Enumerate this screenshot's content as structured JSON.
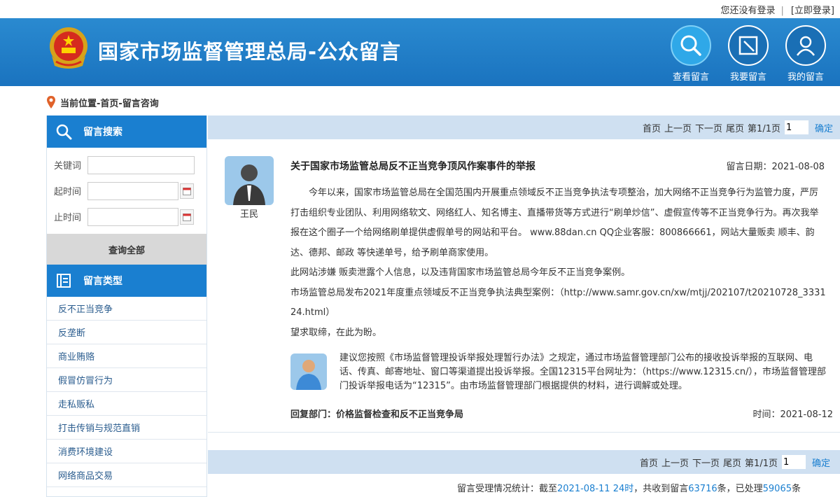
{
  "topbar": {
    "not_logged": "您还没有登录",
    "separator": "|",
    "login": "[立即登录]"
  },
  "header": {
    "site_title": "国家市场监督管理总局-公众留言"
  },
  "nav": [
    {
      "label": "查看留言",
      "icon": "search-icon"
    },
    {
      "label": "我要留言",
      "icon": "compose-icon"
    },
    {
      "label": "我的留言",
      "icon": "user-icon"
    }
  ],
  "breadcrumb": "当前位置-首页-留言咨询",
  "sidebar": {
    "search_title": "留言搜索",
    "keyword_label": "关键词",
    "start_label": "起时间",
    "end_label": "止时间",
    "query_all": "查询全部",
    "types_title": "留言类型",
    "types": [
      "反不正当竞争",
      "反垄断",
      "商业贿赂",
      "假冒仿冒行为",
      "走私贩私",
      "打击传销与规范直销",
      "消费环境建设",
      "网络商品交易"
    ]
  },
  "pager": {
    "first": "首页",
    "prev": "上一页",
    "next": "下一页",
    "last": "尾页",
    "page_info": "第1/1页",
    "page_value": "1",
    "confirm": "确定"
  },
  "message": {
    "author": "王民",
    "title": "关于国家市场监管总局反不正当竞争顶风作案事件的举报",
    "date": "留言日期：2021-08-08",
    "body": [
      "今年以来，国家市场监管总局在全国范围内开展重点领域反不正当竞争执法专项整治，加大网络不正当竞争行为监管力度，严厉打击组织专业团队、利用网络软文、网络红人、知名博主、直播带货等方式进行“刷单炒信”、虚假宣传等不正当竞争行为。再次我举报在这个圈子一个给网络刷单提供虚假单号的网站和平台。 www.88dan.cn QQ企业客服：800866661，网站大量贩卖 顺丰、韵达、德邦、邮政 等快递单号，给予刷单商家使用。",
      "此网站涉嫌 贩卖泄露个人信息，以及违背国家市场监管总局今年反不正当竞争案例。",
      "市场监管总局发布2021年度重点领域反不正当竞争执法典型案例：（http://www.samr.gov.cn/xw/mtjj/202107/t20210728_333124.html）",
      "望求取缔，在此为盼。"
    ]
  },
  "reply": {
    "text": "建议您按照《市场监督管理投诉举报处理暂行办法》之规定，通过市场监督管理部门公布的接收投诉举报的互联网、电话、传真、邮寄地址、窗口等渠道提出投诉举报。全国12315平台网址为：（https://www.12315.cn/），市场监督管理部门投诉举报电话为“12315”。由市场监督管理部门根据提供的材料，进行调解或处理。",
    "dept": "回复部门：价格监督检查和反不正当竞争局",
    "time": "时间：2021-08-12"
  },
  "stats": {
    "prefix": "留言受理情况统计：截至",
    "date": "2021-08-11 24时",
    "mid": "，共收到留言",
    "received": "63716",
    "unit1": "条，已处理",
    "handled": "59065",
    "unit2": "条"
  },
  "colors": {
    "header_blue": "#1a7fd0",
    "pager_bg": "#cfe0f1",
    "link_blue": "#2a5c8e"
  }
}
